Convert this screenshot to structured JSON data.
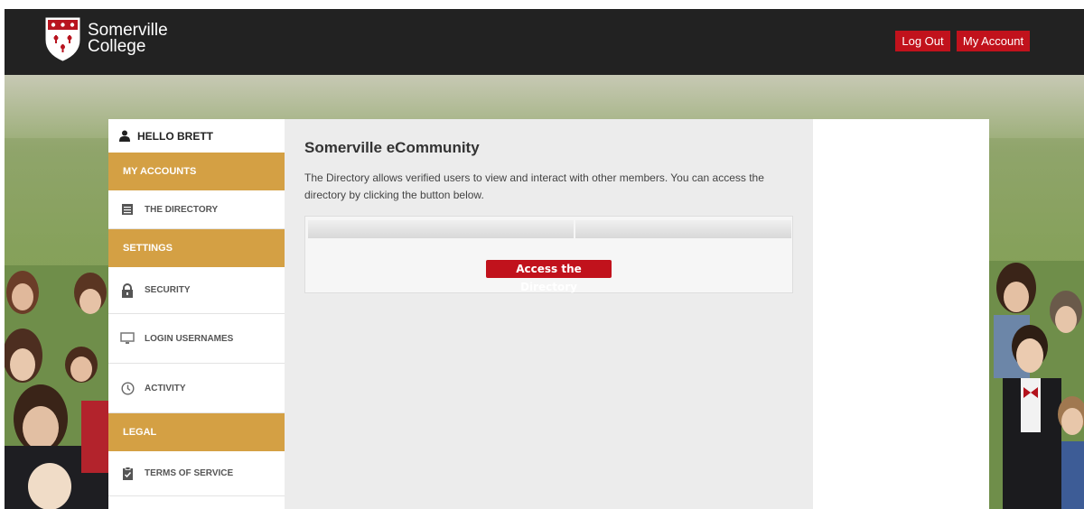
{
  "header": {
    "brand_line1": "Somerville",
    "brand_line2": "College",
    "logout_label": "Log Out",
    "account_label": "My Account"
  },
  "sidebar": {
    "greeting": "HELLO BRETT",
    "sections": [
      {
        "heading": "MY ACCOUNTS"
      },
      {
        "heading": "SETTINGS"
      },
      {
        "heading": "LEGAL"
      }
    ],
    "items": [
      {
        "label": "THE DIRECTORY",
        "icon": "directory-icon"
      },
      {
        "label": "SECURITY",
        "icon": "lock-icon"
      },
      {
        "label": "LOGIN USERNAMES",
        "icon": "monitor-icon"
      },
      {
        "label": "ACTIVITY",
        "icon": "clock-icon"
      },
      {
        "label": "TERMS OF SERVICE",
        "icon": "clipboard-check-icon"
      }
    ]
  },
  "main": {
    "title": "Somerville eCommunity",
    "description": "The Directory allows verified users to view and interact with other members. You can access the directory by clicking the button below.",
    "access_button_label": "Access the Directory"
  },
  "colors": {
    "header_bg": "#222222",
    "accent_red": "#c1121c",
    "section_gold": "#d4a044",
    "content_bg": "#ececec"
  }
}
